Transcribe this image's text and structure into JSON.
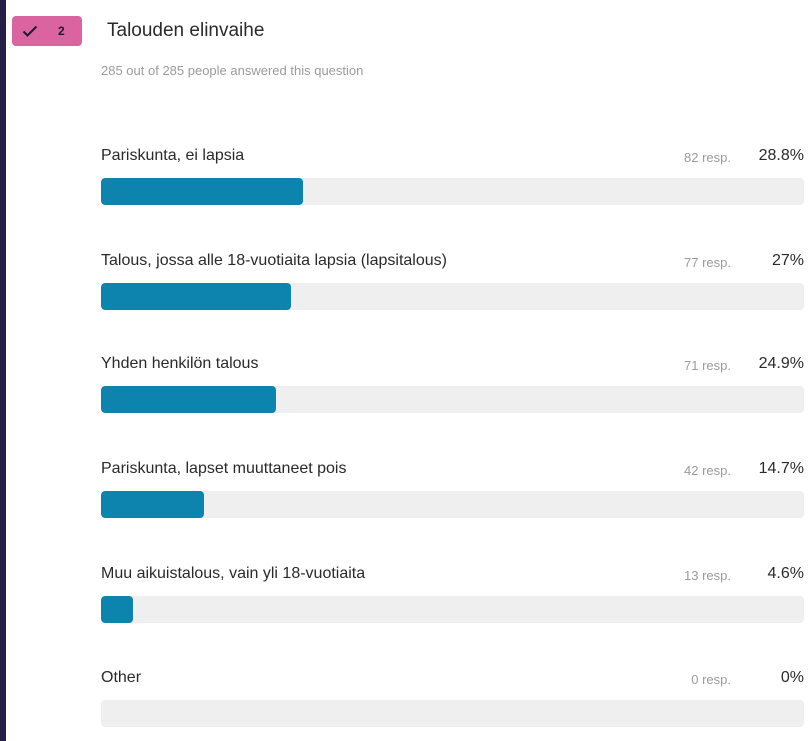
{
  "question": {
    "number": "2",
    "title": "Talouden elinvaihe",
    "answered_summary": "285 out of 285 people answered this question"
  },
  "colors": {
    "badge": "#d9649f",
    "bar_fill": "#0c84ad",
    "bar_track": "#efefef",
    "frame": "#262048"
  },
  "options": [
    {
      "label": "Pariskunta, ei lapsia",
      "responses": "82 resp.",
      "percent": "28.8%",
      "fraction": 0.288
    },
    {
      "label": "Talous, jossa alle 18-vuotiaita lapsia (lapsitalous)",
      "responses": "77 resp.",
      "percent": "27%",
      "fraction": 0.27
    },
    {
      "label": "Yhden henkilön talous",
      "responses": "71 resp.",
      "percent": "24.9%",
      "fraction": 0.249
    },
    {
      "label": "Pariskunta, lapset muuttaneet pois",
      "responses": "42 resp.",
      "percent": "14.7%",
      "fraction": 0.147
    },
    {
      "label": "Muu aikuistalous, vain yli 18-vuotiaita",
      "responses": "13 resp.",
      "percent": "4.6%",
      "fraction": 0.046
    },
    {
      "label": "Other",
      "responses": "0 resp.",
      "percent": "0%",
      "fraction": 0
    }
  ]
}
